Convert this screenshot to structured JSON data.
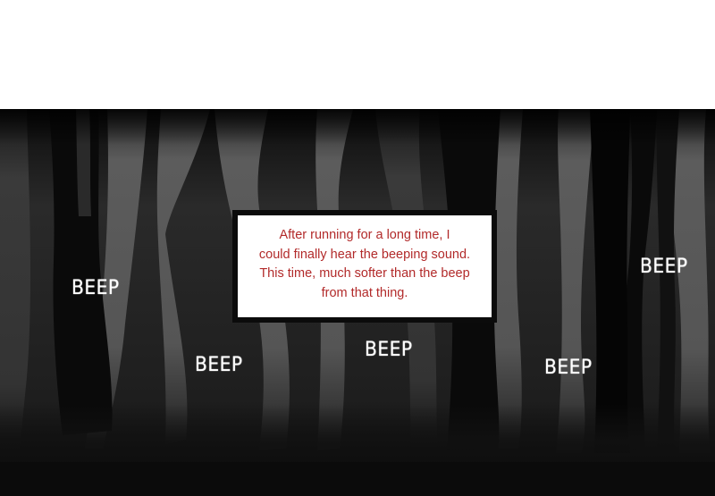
{
  "narration": {
    "lines": [
      "After running for a long time, I",
      "could finally hear the beeping sound.",
      "This time, much softer than the beep",
      "from that thing."
    ],
    "text_color": "#b22a2a"
  },
  "sound_effects": [
    {
      "id": "beep-1",
      "text": "BEEP"
    },
    {
      "id": "beep-2",
      "text": "BEEP"
    },
    {
      "id": "beep-3",
      "text": "BEEP"
    },
    {
      "id": "beep-4",
      "text": "BEEP"
    },
    {
      "id": "beep-5",
      "text": "BEEP"
    }
  ],
  "scene": {
    "background": "dark-forest",
    "colors": {
      "sky": "#ffffff",
      "backdrop": "#1a1a1a",
      "trunk_light": "#5f5f5f",
      "trunk_mid": "#3c3c3c",
      "trunk_dark": "#0a0a0a",
      "ground": "#111111",
      "effect_text": "#ffffff"
    }
  }
}
